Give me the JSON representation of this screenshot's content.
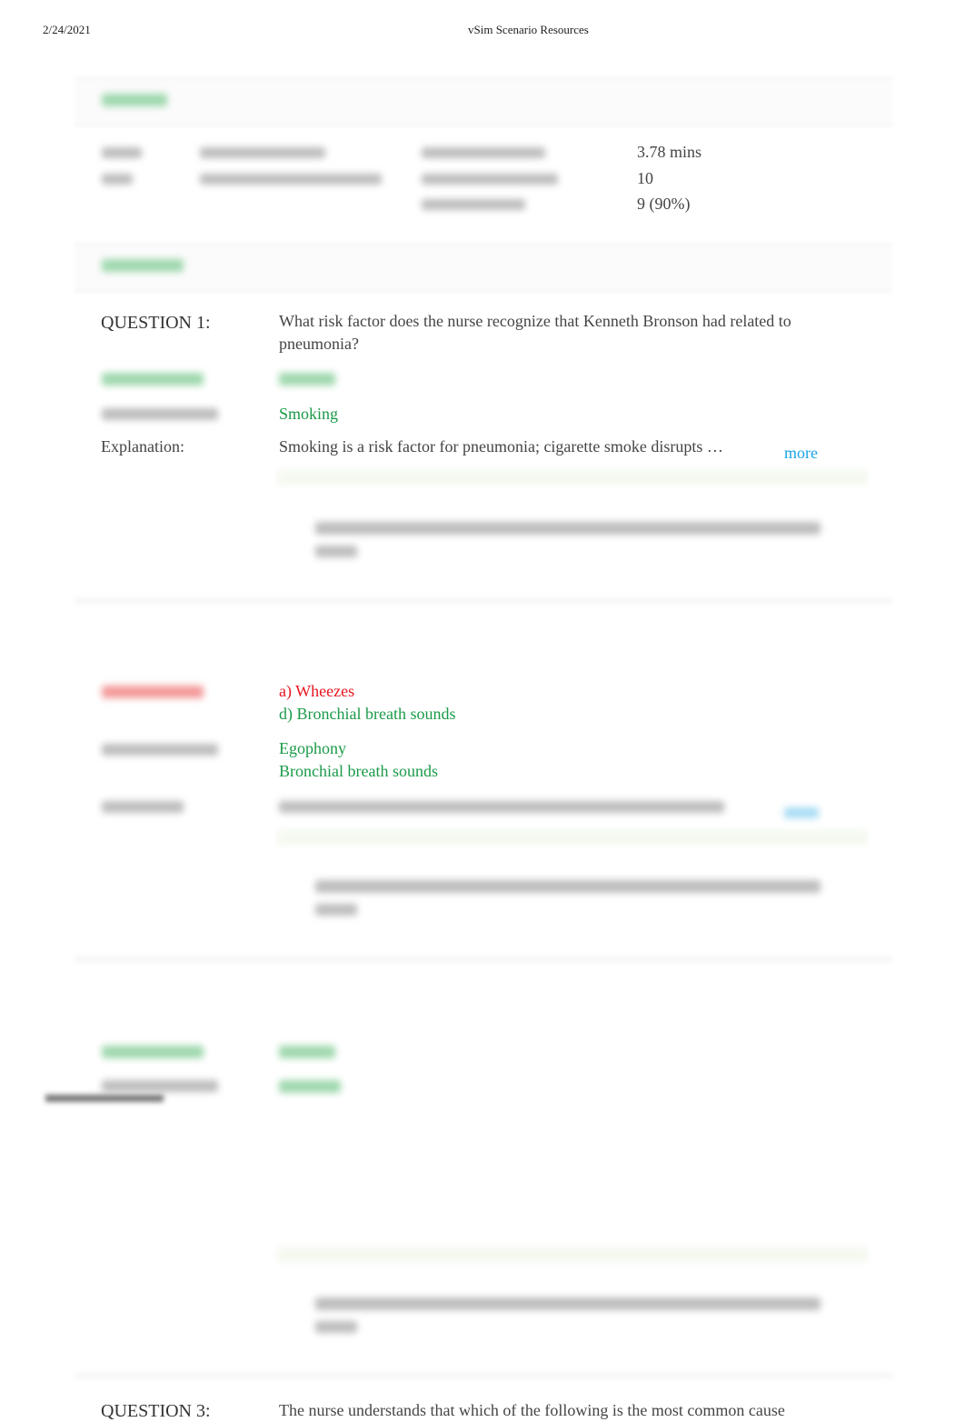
{
  "print_header": {
    "date": "2/24/2021",
    "title": "vSim Scenario Resources"
  },
  "summary": {
    "time_spent": "3.78 mins",
    "questions_answered": "10",
    "correct_count": "9 (90%)"
  },
  "questions": [
    {
      "label": "QUESTION 1:",
      "text": "What risk factor does the nurse recognize that Kenneth Bronson had related to",
      "text_line2": "pneumonia?",
      "correct_response": "Smoking",
      "explanation_label": "Explanation:",
      "explanation": "Smoking is a risk factor for pneumonia; cigarette smoke disrupts …",
      "more_label": "more"
    },
    {
      "your_responses": [
        "a) Wheezes",
        "d) Bronchial breath sounds"
      ],
      "your_response_colors": [
        "#e8141e",
        "#1a9a48"
      ],
      "correct_responses": [
        "Egophony",
        "Bronchial breath sounds"
      ]
    },
    {
      "label": "QUESTION 3:",
      "text": "The nurse understands that which of the following is the most common cause"
    }
  ],
  "colors": {
    "correct": "#1a9a48",
    "incorrect": "#e8141e",
    "link": "#1aa3e8",
    "text": "#444444"
  }
}
